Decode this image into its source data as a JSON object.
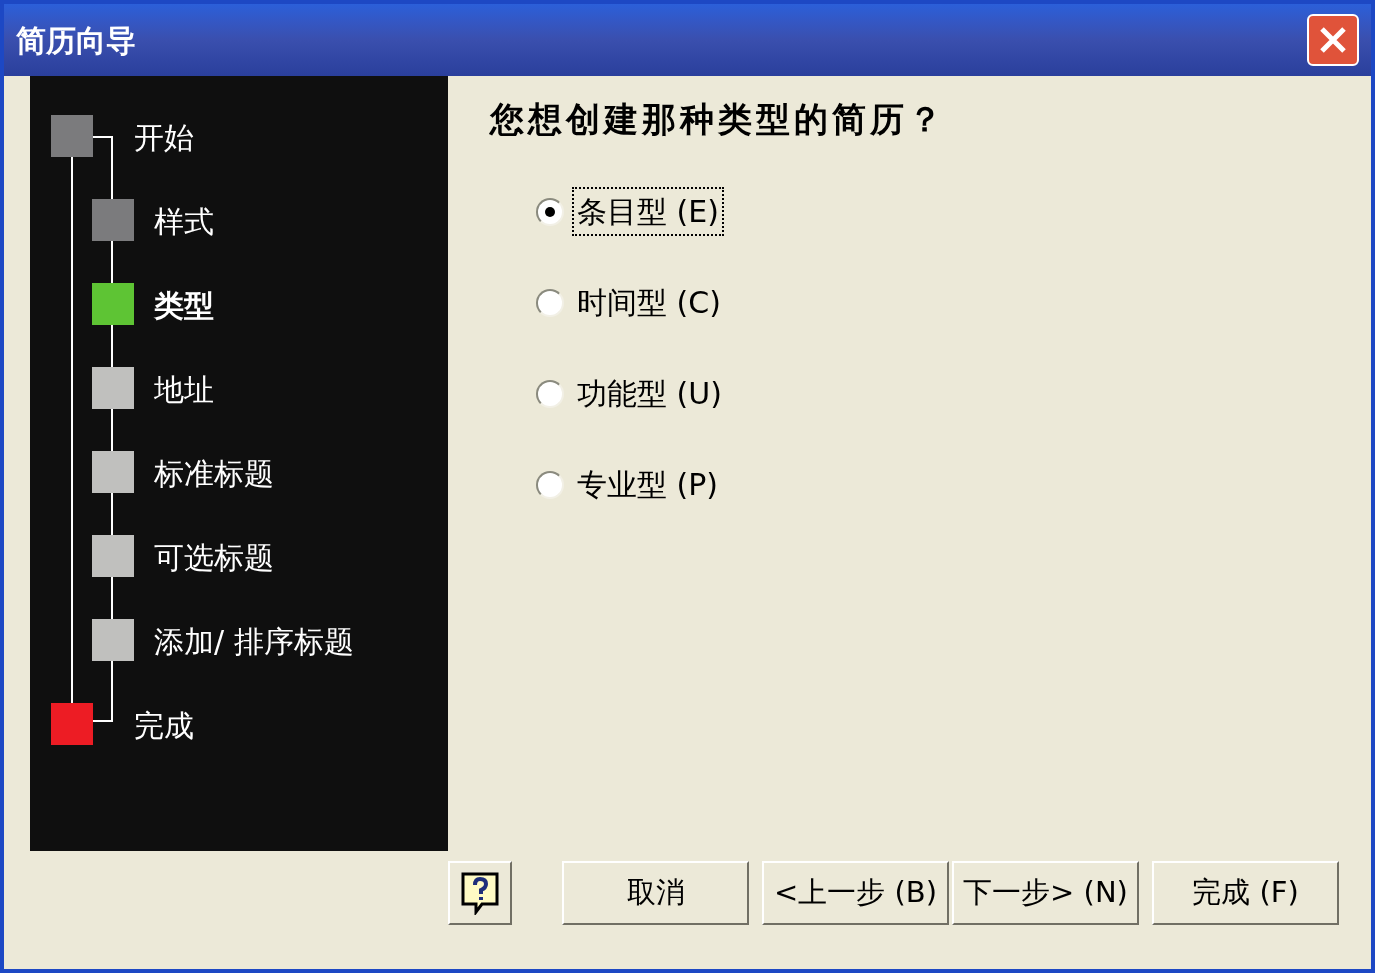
{
  "window": {
    "title": "简历向导"
  },
  "steps": [
    {
      "label": "开始",
      "kind": "endpoint",
      "color": "#7b7b7d",
      "selected": false
    },
    {
      "label": "样式",
      "kind": "step",
      "color": "#7b7b7d",
      "selected": false
    },
    {
      "label": "类型",
      "kind": "step",
      "color": "#5ec434",
      "selected": true
    },
    {
      "label": "地址",
      "kind": "step",
      "color": "#c0c0be",
      "selected": false
    },
    {
      "label": "标准标题",
      "kind": "step",
      "color": "#c0c0be",
      "selected": false
    },
    {
      "label": "可选标题",
      "kind": "step",
      "color": "#c0c0be",
      "selected": false
    },
    {
      "label": "添加/ 排序标题",
      "kind": "step",
      "color": "#c0c0be",
      "selected": false
    },
    {
      "label": "完成",
      "kind": "endpoint",
      "color": "#ed1c24",
      "selected": false
    }
  ],
  "question": "您想创建那种类型的简历？",
  "options": [
    {
      "label": "条目型 (E)",
      "selected": true,
      "focused": true
    },
    {
      "label": "时间型 (C)",
      "selected": false,
      "focused": false
    },
    {
      "label": "功能型 (U)",
      "selected": false,
      "focused": false
    },
    {
      "label": "专业型 (P)",
      "selected": false,
      "focused": false
    }
  ],
  "buttons": [
    "取消",
    "<上一步 (B)",
    "下一步> (N)",
    "完成 (F)"
  ]
}
